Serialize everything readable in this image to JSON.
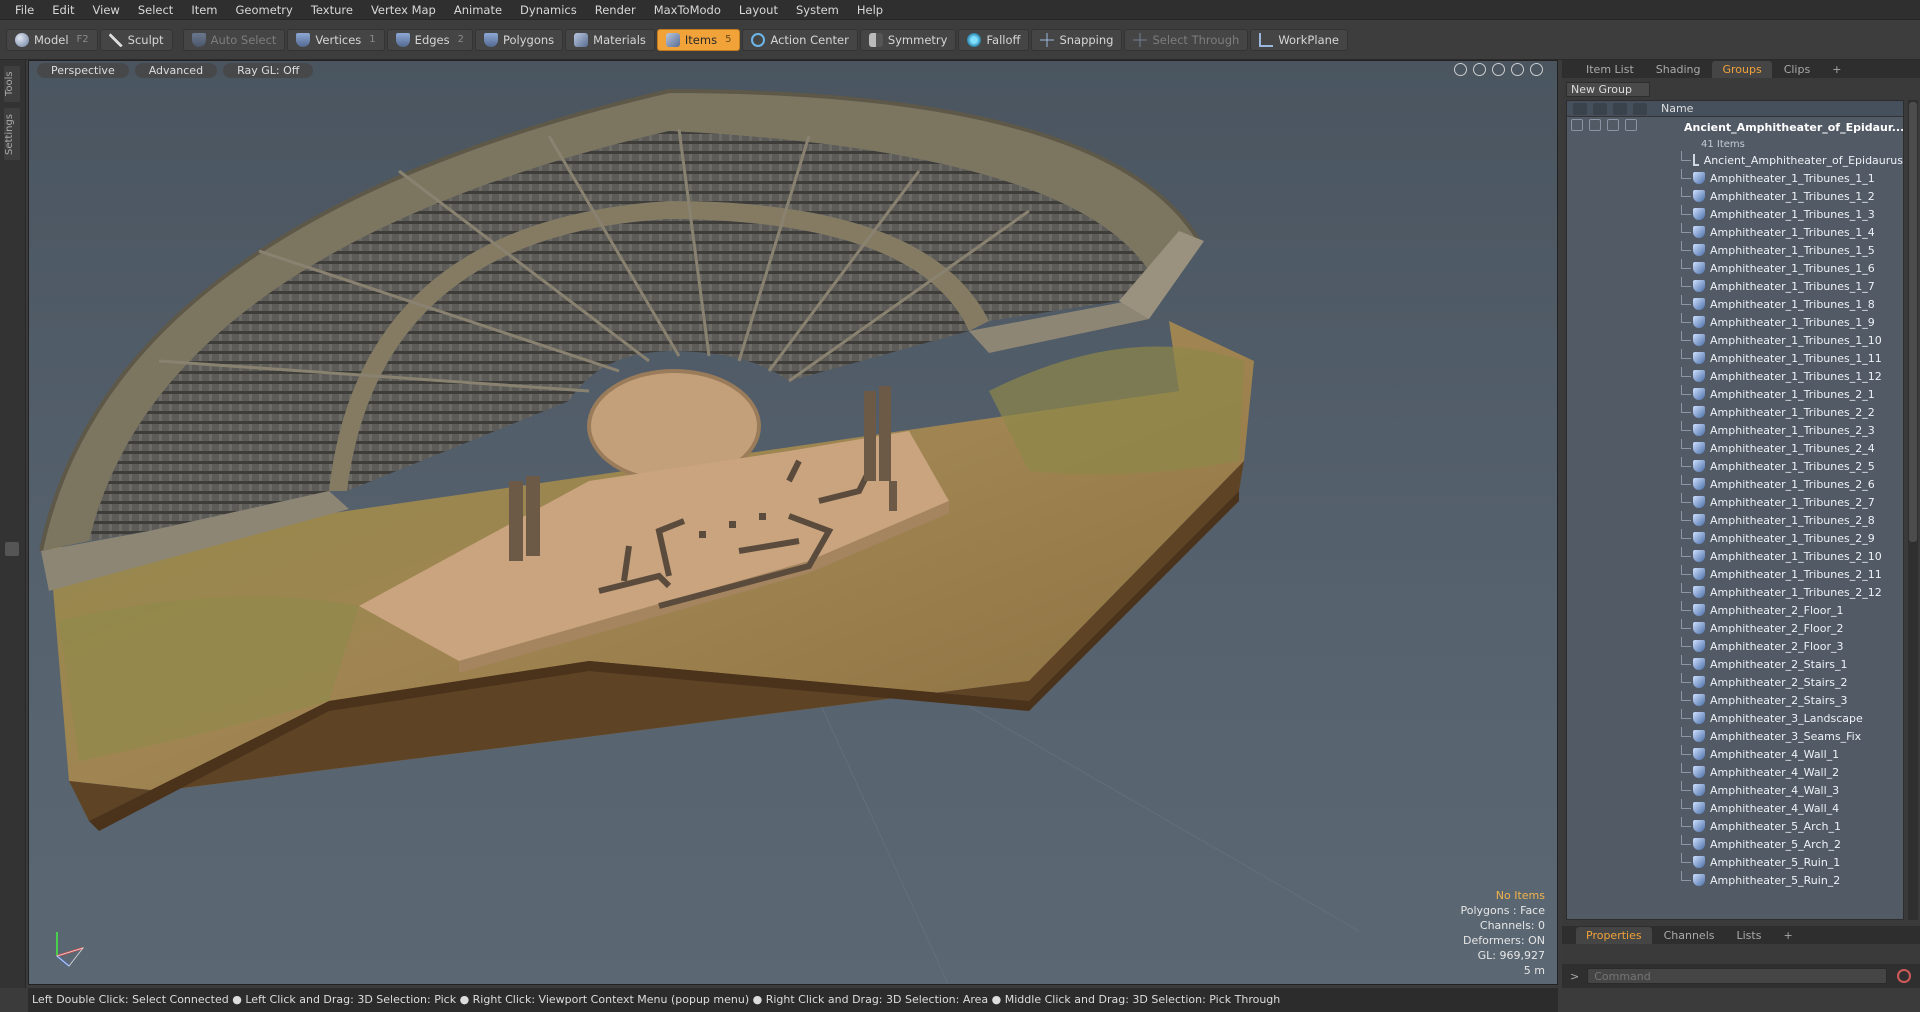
{
  "menu": [
    "File",
    "Edit",
    "View",
    "Select",
    "Item",
    "Geometry",
    "Texture",
    "Vertex Map",
    "Animate",
    "Dynamics",
    "Render",
    "MaxToModo",
    "Layout",
    "System",
    "Help"
  ],
  "toolbar": {
    "model": "Model",
    "model_key": "F2",
    "sculpt": "Sculpt",
    "auto_select": "Auto Select",
    "vertices": "Vertices",
    "vertices_key": "1",
    "edges": "Edges",
    "edges_key": "2",
    "polygons": "Polygons",
    "materials": "Materials",
    "items": "Items",
    "items_key": "5",
    "action_center": "Action Center",
    "symmetry": "Symmetry",
    "falloff": "Falloff",
    "snapping": "Snapping",
    "select_through": "Select Through",
    "workplane": "WorkPlane",
    "active_color": "#f1a33a"
  },
  "left_tabs": {
    "tools": "Tools",
    "settings": "Settings"
  },
  "viewport": {
    "view": "Perspective",
    "shading": "Advanced",
    "raygl": "Ray GL: Off",
    "info": {
      "selection": "No Items",
      "polygons": "Polygons : Face",
      "channels": "Channels: 0",
      "deformers": "Deformers: ON",
      "gl": "GL: 969,927",
      "scale": "5 m"
    }
  },
  "right_panel": {
    "tabs": [
      "Item List",
      "Shading",
      "Groups",
      "Clips",
      "+"
    ],
    "new_group": "New Group",
    "column_name": "Name",
    "root": {
      "label": "Ancient_Amphitheater_of_Epidaur...",
      "count": "41 Items"
    },
    "items": [
      "Ancient_Amphitheater_of_Epidaurus",
      "Amphitheater_1_Tribunes_1_1",
      "Amphitheater_1_Tribunes_1_2",
      "Amphitheater_1_Tribunes_1_3",
      "Amphitheater_1_Tribunes_1_4",
      "Amphitheater_1_Tribunes_1_5",
      "Amphitheater_1_Tribunes_1_6",
      "Amphitheater_1_Tribunes_1_7",
      "Amphitheater_1_Tribunes_1_8",
      "Amphitheater_1_Tribunes_1_9",
      "Amphitheater_1_Tribunes_1_10",
      "Amphitheater_1_Tribunes_1_11",
      "Amphitheater_1_Tribunes_1_12",
      "Amphitheater_1_Tribunes_2_1",
      "Amphitheater_1_Tribunes_2_2",
      "Amphitheater_1_Tribunes_2_3",
      "Amphitheater_1_Tribunes_2_4",
      "Amphitheater_1_Tribunes_2_5",
      "Amphitheater_1_Tribunes_2_6",
      "Amphitheater_1_Tribunes_2_7",
      "Amphitheater_1_Tribunes_2_8",
      "Amphitheater_1_Tribunes_2_9",
      "Amphitheater_1_Tribunes_2_10",
      "Amphitheater_1_Tribunes_2_11",
      "Amphitheater_1_Tribunes_2_12",
      "Amphitheater_2_Floor_1",
      "Amphitheater_2_Floor_2",
      "Amphitheater_2_Floor_3",
      "Amphitheater_2_Stairs_1",
      "Amphitheater_2_Stairs_2",
      "Amphitheater_2_Stairs_3",
      "Amphitheater_3_Landscape",
      "Amphitheater_3_Seams_Fix",
      "Amphitheater_4_Wall_1",
      "Amphitheater_4_Wall_2",
      "Amphitheater_4_Wall_3",
      "Amphitheater_4_Wall_4",
      "Amphitheater_5_Arch_1",
      "Amphitheater_5_Arch_2",
      "Amphitheater_5_Ruin_1",
      "Amphitheater_5_Ruin_2"
    ],
    "bottom_tabs": [
      "Properties",
      "Channels",
      "Lists",
      "+"
    ],
    "command_placeholder": "Command"
  },
  "status": "Left Double Click: Select Connected ● Left Click and Drag: 3D Selection: Pick ● Right Click: Viewport Context Menu (popup menu) ● Right Click and Drag: 3D Selection: Area ● Middle Click and Drag: 3D Selection: Pick Through"
}
